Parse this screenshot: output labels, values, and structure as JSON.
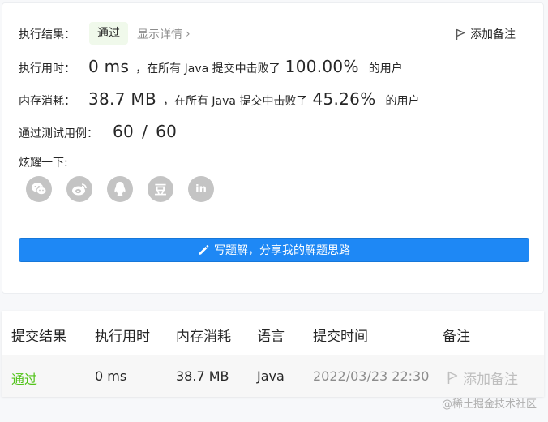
{
  "result": {
    "label": "执行结果：",
    "status": "通过",
    "show_details": "显示详情",
    "chevron": "›",
    "add_note": "添加备注"
  },
  "runtime": {
    "label": "执行用时：",
    "value": "0 ms",
    "beat_text": "，在所有 Java 提交中击败了",
    "percent": "100.00%",
    "users": "的用户"
  },
  "memory": {
    "label": "内存消耗：",
    "value": "38.7 MB",
    "beat_text": "，在所有 Java 提交中击败了",
    "percent": "45.26%",
    "users": "的用户"
  },
  "tests": {
    "label": "通过测试用例：",
    "passed": "60",
    "sep": "/",
    "total": "60"
  },
  "share": {
    "label": "炫耀一下:",
    "icons": [
      "wechat-icon",
      "weibo-icon",
      "qq-icon",
      "douban-icon",
      "linkedin-icon"
    ],
    "douban_glyph": "豆",
    "linkedin_glyph": "in"
  },
  "write_button": "写题解，分享我的解题思路",
  "table": {
    "headers": [
      "提交结果",
      "执行用时",
      "内存消耗",
      "语言",
      "提交时间",
      "备注"
    ],
    "row": {
      "result": "通过",
      "runtime": "0 ms",
      "memory": "38.7 MB",
      "language": "Java",
      "time": "2022/03/23 22:30",
      "note": "添加备注"
    }
  },
  "watermark": "@稀土掘金技术社区",
  "colors": {
    "primary_button": "#1e88f5",
    "success": "#52c41a",
    "pill_bg": "#f0f9eb",
    "share_icon_bg": "#c4c4c4"
  }
}
